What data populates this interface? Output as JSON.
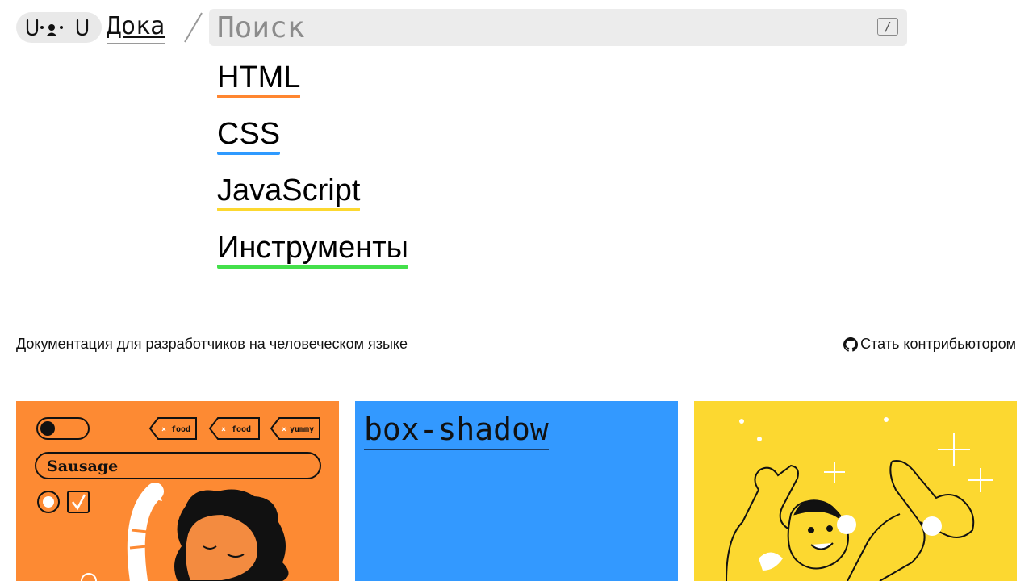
{
  "header": {
    "site_name": "Дока",
    "search": {
      "placeholder": "Поиск",
      "value": "",
      "shortcut_hint": "/"
    }
  },
  "nav": {
    "categories": [
      {
        "label": "HTML",
        "color": "#ff8630"
      },
      {
        "label": "CSS",
        "color": "#2e9aff"
      },
      {
        "label": "JavaScript",
        "color": "#fcd830"
      },
      {
        "label": "Инструменты",
        "color": "#44e04b"
      }
    ]
  },
  "intro": {
    "tagline": "Документация для разработчиков на человеческом языке",
    "contribute_label": "Стать контрибьютором"
  },
  "cards": [
    {
      "color": "#fd8a33",
      "illustration": "food-tags-form",
      "tags": [
        "food",
        "food",
        "yummy"
      ],
      "field_text": "Sausage"
    },
    {
      "color": "#3399ff",
      "title": "box-shadow"
    },
    {
      "color": "#fcd830",
      "illustration": "relaxing-person"
    }
  ],
  "icons": {
    "logo": "doka-logo-icon",
    "separator": "slash-separator-icon",
    "github": "github-icon"
  }
}
